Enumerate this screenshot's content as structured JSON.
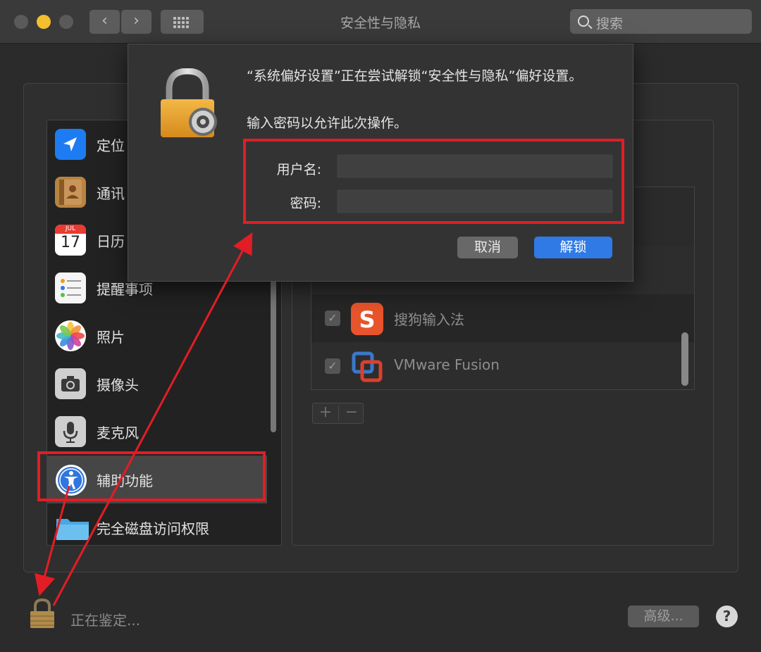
{
  "window": {
    "title": "安全性与隐私",
    "search_placeholder": "搜索"
  },
  "sidebar": {
    "items": [
      {
        "label": "定位"
      },
      {
        "label": "通讯"
      },
      {
        "label": "日历"
      },
      {
        "label": "提醒事项"
      },
      {
        "label": "照片"
      },
      {
        "label": "摄像头"
      },
      {
        "label": "麦克风"
      },
      {
        "label": "辅助功能"
      },
      {
        "label": "完全磁盘访问权限"
      }
    ],
    "calendar_month": "JUL",
    "calendar_day": "17"
  },
  "apps": [
    {
      "name": "搜狗输入法",
      "checked": true
    },
    {
      "name": "VMware Fusion",
      "checked": true
    }
  ],
  "list_controls": {
    "add": "+",
    "remove": "−"
  },
  "footer": {
    "auth_status": "正在鉴定...",
    "advanced_label": "高级...",
    "help_label": "?"
  },
  "dialog": {
    "message": "“系统偏好设置”正在尝试解锁“安全性与隐私”偏好设置。",
    "sub_message": "输入密码以允许此次操作。",
    "username_label": "用户名:",
    "password_label": "密码:",
    "username_value": "",
    "password_value": "",
    "cancel_label": "取消",
    "unlock_label": "解锁"
  },
  "colors": {
    "annotation_red": "#e21d25",
    "accent_blue": "#2f7ae5",
    "minimize_yellow": "#f4bf2d"
  }
}
